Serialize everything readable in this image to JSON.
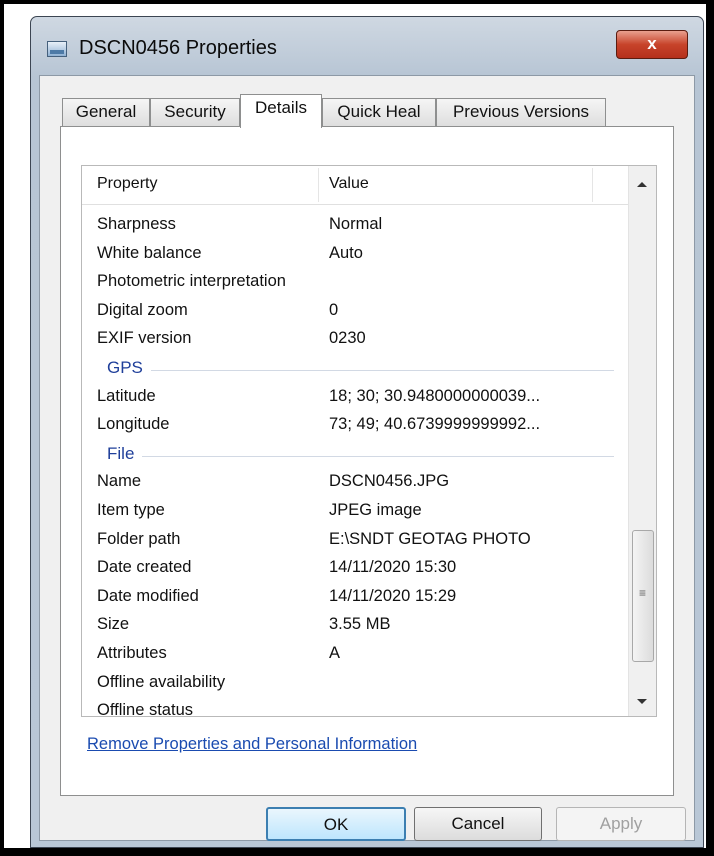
{
  "window": {
    "title": "DSCN0456 Properties",
    "close_glyph": "x"
  },
  "tabs": [
    {
      "label": "General"
    },
    {
      "label": "Security"
    },
    {
      "label": "Details"
    },
    {
      "label": "Quick Heal"
    },
    {
      "label": "Previous Versions"
    }
  ],
  "active_tab": "Details",
  "table": {
    "columns": {
      "property": "Property",
      "value": "Value"
    },
    "rows": [
      {
        "type": "row",
        "property": "Sharpness",
        "value": "Normal"
      },
      {
        "type": "row",
        "property": "White balance",
        "value": "Auto"
      },
      {
        "type": "row",
        "property": "Photometric interpretation",
        "value": ""
      },
      {
        "type": "row",
        "property": "Digital zoom",
        "value": "0"
      },
      {
        "type": "row",
        "property": "EXIF version",
        "value": "0230"
      },
      {
        "type": "group",
        "label": "GPS"
      },
      {
        "type": "row",
        "property": "Latitude",
        "value": "18; 30; 30.9480000000039..."
      },
      {
        "type": "row",
        "property": "Longitude",
        "value": "73; 49; 40.6739999999992..."
      },
      {
        "type": "group",
        "label": "File"
      },
      {
        "type": "row",
        "property": "Name",
        "value": "DSCN0456.JPG"
      },
      {
        "type": "row",
        "property": "Item type",
        "value": "JPEG image"
      },
      {
        "type": "row",
        "property": "Folder path",
        "value": "E:\\SNDT GEOTAG PHOTO"
      },
      {
        "type": "row",
        "property": "Date created",
        "value": "14/11/2020 15:30"
      },
      {
        "type": "row",
        "property": "Date modified",
        "value": "14/11/2020 15:29"
      },
      {
        "type": "row",
        "property": "Size",
        "value": "3.55 MB"
      },
      {
        "type": "row",
        "property": "Attributes",
        "value": "A"
      },
      {
        "type": "row",
        "property": "Offline availability",
        "value": ""
      },
      {
        "type": "row",
        "property": "Offline status",
        "value": ""
      }
    ]
  },
  "remove_link": "Remove Properties and Personal Information",
  "buttons": {
    "ok": "OK",
    "cancel": "Cancel",
    "apply": "Apply"
  },
  "scrollbar": {
    "grip_glyph": "≡"
  }
}
